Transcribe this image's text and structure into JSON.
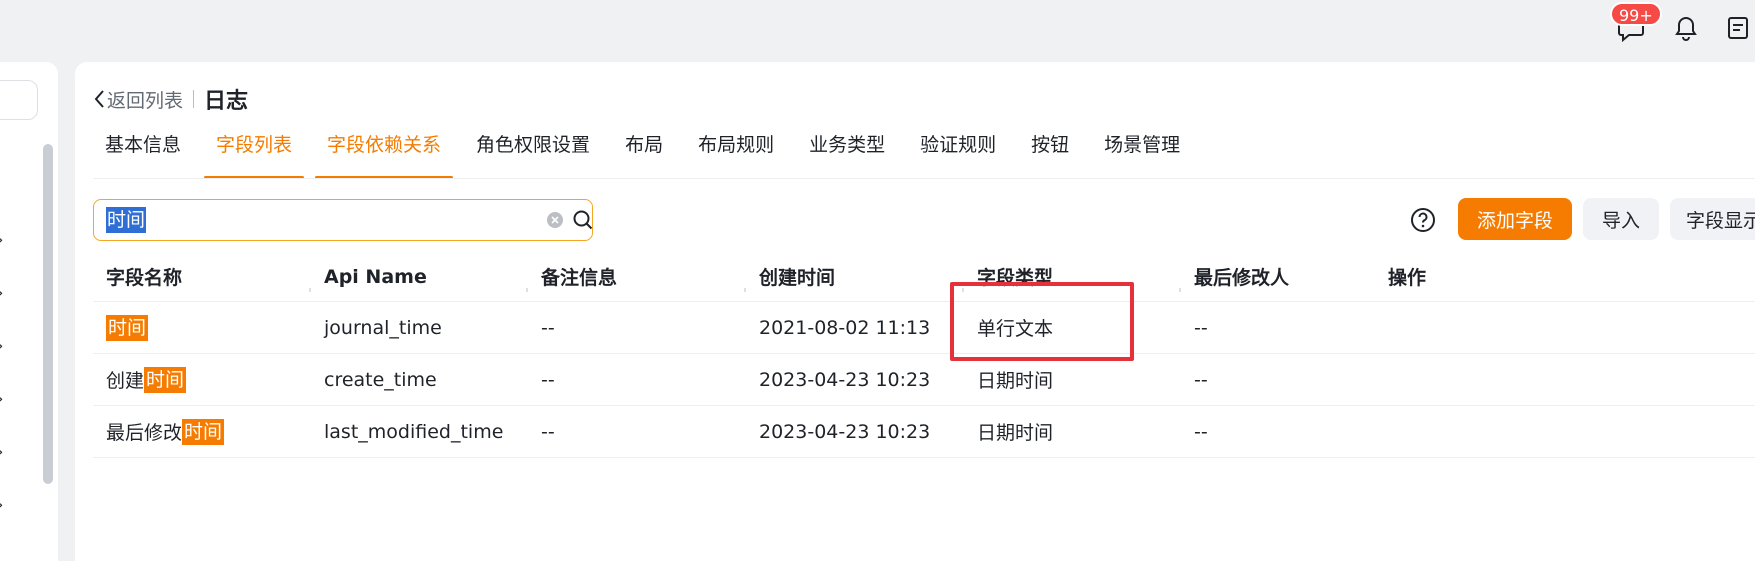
{
  "topbar": {
    "badge": "99+",
    "icons": [
      "chat-icon",
      "bell-icon",
      "document-icon"
    ]
  },
  "breadcrumb": {
    "back_label": "返回列表",
    "title": "日志"
  },
  "tabs": [
    {
      "label": "基本信息"
    },
    {
      "label": "字段列表"
    },
    {
      "label": "字段依赖关系"
    },
    {
      "label": "角色权限设置"
    },
    {
      "label": "布局"
    },
    {
      "label": "布局规则"
    },
    {
      "label": "业务类型"
    },
    {
      "label": "验证规则"
    },
    {
      "label": "按钮"
    },
    {
      "label": "场景管理"
    }
  ],
  "search": {
    "value": "时间"
  },
  "toolbar": {
    "add_field": "添加字段",
    "import": "导入",
    "field_display": "字段显示"
  },
  "table": {
    "headers": [
      "字段名称",
      "Api Name",
      "备注信息",
      "创建时间",
      "字段类型",
      "最后修改人",
      "操作"
    ],
    "rows": [
      {
        "name_prefix": "",
        "name_match": "时间",
        "api_name": "journal_time",
        "remark": "--",
        "created": "2021-08-02 11:13",
        "type": "单行文本",
        "modifier": "--"
      },
      {
        "name_prefix": "创建",
        "name_match": "时间",
        "api_name": "create_time",
        "remark": "--",
        "created": "2023-04-23 10:23",
        "type": "日期时间",
        "modifier": "--"
      },
      {
        "name_prefix": "最后修改",
        "name_match": "时间",
        "api_name": "last_modified_time",
        "remark": "--",
        "created": "2023-04-23 10:23",
        "type": "日期时间",
        "modifier": "--"
      }
    ]
  },
  "colors": {
    "accent": "#f57c00",
    "highlight": "#2f6ed4",
    "annotation": "#e5323a",
    "badge": "#f54a45"
  }
}
